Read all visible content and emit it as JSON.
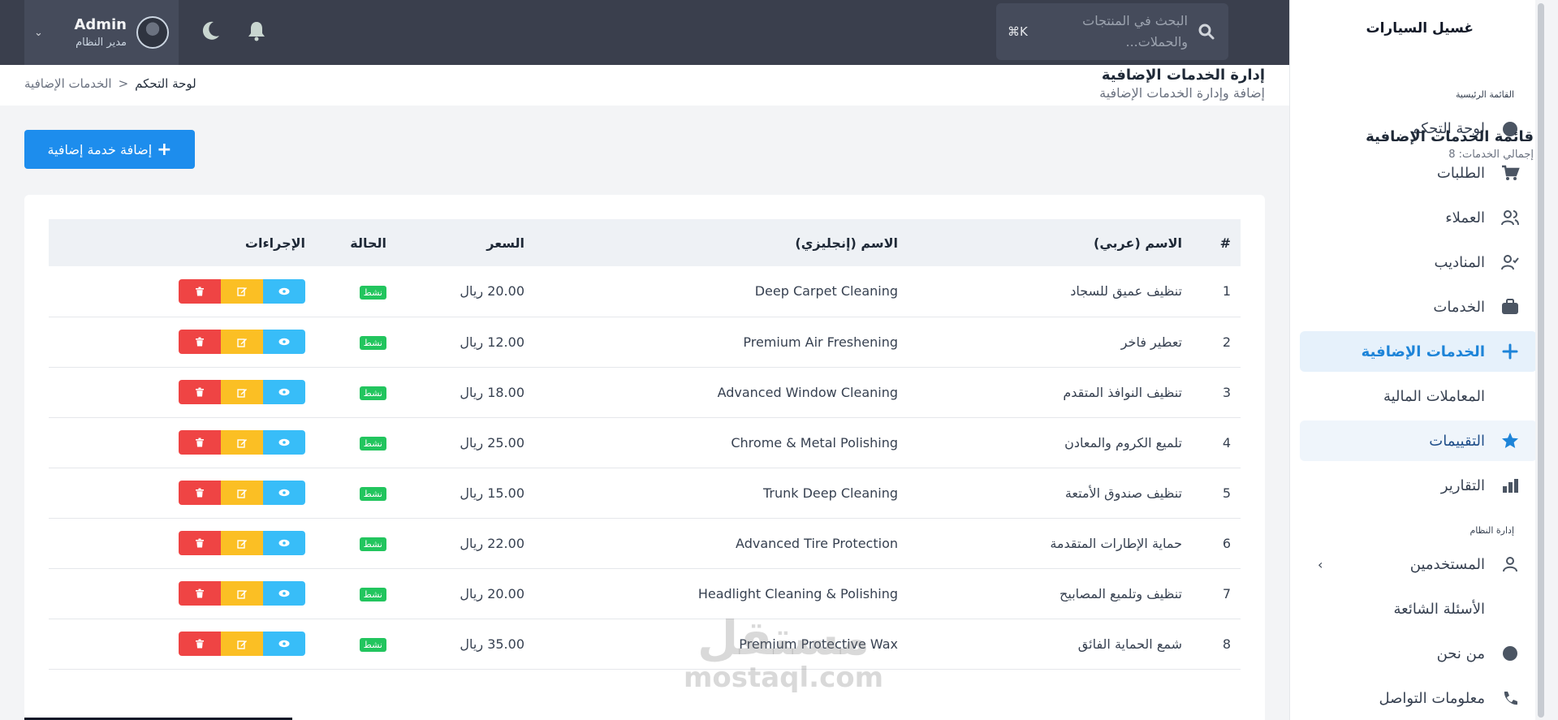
{
  "header": {
    "user_name": "Admin",
    "user_role": "مدير النظام",
    "search_placeholder": "البحث في المنتجات والحملات...",
    "search_shortcut": "⌘K"
  },
  "sidebar": {
    "brand": "غسيل السيارات",
    "main_section_label": "القائمة الرئيسية",
    "admin_section_label": "إدارة النظام",
    "items": [
      {
        "label": "لوحة التحكم",
        "icon": "dashboard-icon"
      },
      {
        "label": "الطلبات",
        "icon": "cart-icon"
      },
      {
        "label": "العملاء",
        "icon": "users-icon"
      },
      {
        "label": "المناديب",
        "icon": "user-check-icon"
      },
      {
        "label": "الخدمات",
        "icon": "briefcase-icon"
      },
      {
        "label": "الخدمات الإضافية",
        "icon": "plus-icon"
      },
      {
        "label": "المعاملات المالية",
        "icon": ""
      },
      {
        "label": "التقييمات",
        "icon": "star-icon"
      },
      {
        "label": "التقارير",
        "icon": "chart-icon"
      }
    ],
    "admin_items": [
      {
        "label": "المستخدمين",
        "icon": "user-icon"
      },
      {
        "label": "الأسئلة الشائعة",
        "icon": ""
      },
      {
        "label": "من نحن",
        "icon": "circle-icon"
      },
      {
        "label": "معلومات التواصل",
        "icon": "phone-icon"
      }
    ]
  },
  "page": {
    "title": "إدارة الخدمات الإضافية",
    "subtitle": "إضافة وإدارة الخدمات الإضافية",
    "breadcrumb_home": "لوحة التحكم",
    "breadcrumb_current": "الخدمات الإضافية",
    "breadcrumb_sep": "<"
  },
  "list": {
    "title": "قائمة الخدمات الإضافية",
    "total_label": "إجمالي الخدمات: 8",
    "add_button": "إضافة خدمة إضافية"
  },
  "table": {
    "headers": [
      "#",
      "الاسم (عربي)",
      "الاسم (إنجليزي)",
      "السعر",
      "الحالة",
      "الإجراءات"
    ],
    "rows": [
      {
        "num": "1",
        "ar": "تنظيف عميق للسجاد",
        "en": "Deep Carpet Cleaning",
        "price": "20.00 ريال",
        "status": "نشط"
      },
      {
        "num": "2",
        "ar": "تعطير فاخر",
        "en": "Premium Air Freshening",
        "price": "12.00 ريال",
        "status": "نشط"
      },
      {
        "num": "3",
        "ar": "تنظيف النوافذ المتقدم",
        "en": "Advanced Window Cleaning",
        "price": "18.00 ريال",
        "status": "نشط"
      },
      {
        "num": "4",
        "ar": "تلميع الكروم والمعادن",
        "en": "Chrome & Metal Polishing",
        "price": "25.00 ريال",
        "status": "نشط"
      },
      {
        "num": "5",
        "ar": "تنظيف صندوق الأمتعة",
        "en": "Trunk Deep Cleaning",
        "price": "15.00 ريال",
        "status": "نشط"
      },
      {
        "num": "6",
        "ar": "حماية الإطارات المتقدمة",
        "en": "Advanced Tire Protection",
        "price": "22.00 ريال",
        "status": "نشط"
      },
      {
        "num": "7",
        "ar": "تنظيف وتلميع المصابيح",
        "en": "Headlight Cleaning & Polishing",
        "price": "20.00 ريال",
        "status": "نشط"
      },
      {
        "num": "8",
        "ar": "شمع الحماية الفائق",
        "en": "Premium Protective Wax",
        "price": "35.00 ريال",
        "status": "نشط"
      }
    ]
  },
  "watermark": {
    "line1": "مستقل",
    "line2": "mostaql.com"
  },
  "colors": {
    "topbar": "#3a3f4d",
    "accent": "#1d8ded",
    "success": "#22c55e",
    "danger": "#ef4444",
    "warning": "#fbbf24",
    "info": "#38bdf8"
  }
}
